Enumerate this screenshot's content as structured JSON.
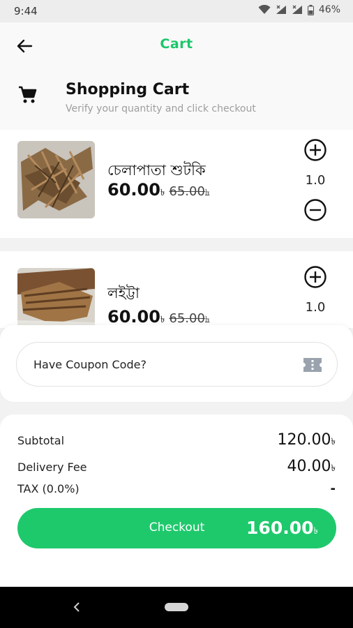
{
  "status_bar": {
    "time": "9:44",
    "battery": "46%",
    "icons": [
      "wifi-icon",
      "signal-icon",
      "battery-icon"
    ]
  },
  "app_bar": {
    "title": "Cart",
    "back_icon": "arrow-left-icon"
  },
  "cart_header": {
    "icon": "shopping-cart-icon",
    "title": "Shopping Cart",
    "subtitle": "Verify your quantity and click checkout"
  },
  "items": [
    {
      "name": "চেলাপাতা শুটকি",
      "price": "60.00",
      "old_price": "65.00",
      "currency": "৳",
      "quantity": "1.0"
    },
    {
      "name": "লইট্টা",
      "price": "60.00",
      "old_price": "65.00",
      "currency": "৳",
      "quantity": "1.0"
    }
  ],
  "coupon": {
    "placeholder": "Have Coupon Code?",
    "icon": "ticket-icon"
  },
  "summary": {
    "subtotal_label": "Subtotal",
    "subtotal_value": "120.00",
    "delivery_label": "Delivery Fee",
    "delivery_value": "40.00",
    "tax_label": "TAX (0.0%)",
    "tax_value": "-",
    "currency": "৳"
  },
  "checkout": {
    "label": "Checkout",
    "total": "160.00",
    "currency": "৳"
  },
  "colors": {
    "accent": "#1bc66b",
    "button": "#1ec96c",
    "nav_bar": "#000000"
  }
}
